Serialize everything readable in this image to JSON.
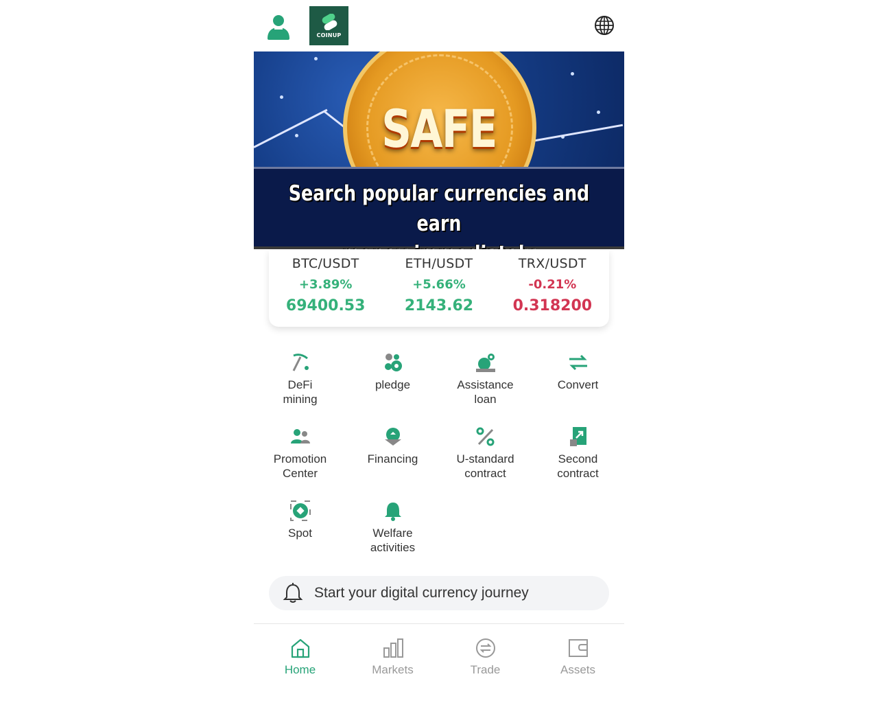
{
  "header": {
    "logo_text": "COINUP",
    "brand_color": "#1e5a45"
  },
  "banner": {
    "headline": "SAFE",
    "caption_line1": "Search popular currencies and earn",
    "caption_line2": "money immediately"
  },
  "ticker": [
    {
      "pair": "BTC/USDT",
      "change": "+3.89%",
      "price": "69400.53",
      "trend": "up"
    },
    {
      "pair": "ETH/USDT",
      "change": "+5.66%",
      "price": "2143.62",
      "trend": "up"
    },
    {
      "pair": "TRX/USDT",
      "change": "-0.21%",
      "price": "0.318200",
      "trend": "down"
    }
  ],
  "features": [
    {
      "label_1": "DeFi",
      "label_2": "mining",
      "icon": "pickaxe-icon"
    },
    {
      "label_1": "pledge",
      "label_2": "",
      "icon": "coins-icon"
    },
    {
      "label_1": "Assistance",
      "label_2": "loan",
      "icon": "loan-icon"
    },
    {
      "label_1": "Convert",
      "label_2": "",
      "icon": "convert-arrows-icon"
    },
    {
      "label_1": "Promotion",
      "label_2": "Center",
      "icon": "users-icon"
    },
    {
      "label_1": "Financing",
      "label_2": "",
      "icon": "financing-icon"
    },
    {
      "label_1": "U-standard",
      "label_2": "contract",
      "icon": "percent-icon"
    },
    {
      "label_1": "Second",
      "label_2": "contract",
      "icon": "document-chart-icon"
    },
    {
      "label_1": "Spot",
      "label_2": "",
      "icon": "spot-icon"
    },
    {
      "label_1": "Welfare",
      "label_2": "activities",
      "icon": "bell-icon"
    }
  ],
  "notice": {
    "text": "Start your digital currency journey"
  },
  "nav": [
    {
      "label": "Home",
      "icon": "home-icon",
      "active": true
    },
    {
      "label": "Markets",
      "icon": "bar-chart-icon",
      "active": false
    },
    {
      "label": "Trade",
      "icon": "trade-icon",
      "active": false
    },
    {
      "label": "Assets",
      "icon": "wallet-icon",
      "active": false
    }
  ],
  "colors": {
    "accent": "#27a378",
    "up": "#35b17a",
    "down": "#d23552",
    "muted": "#999999"
  }
}
